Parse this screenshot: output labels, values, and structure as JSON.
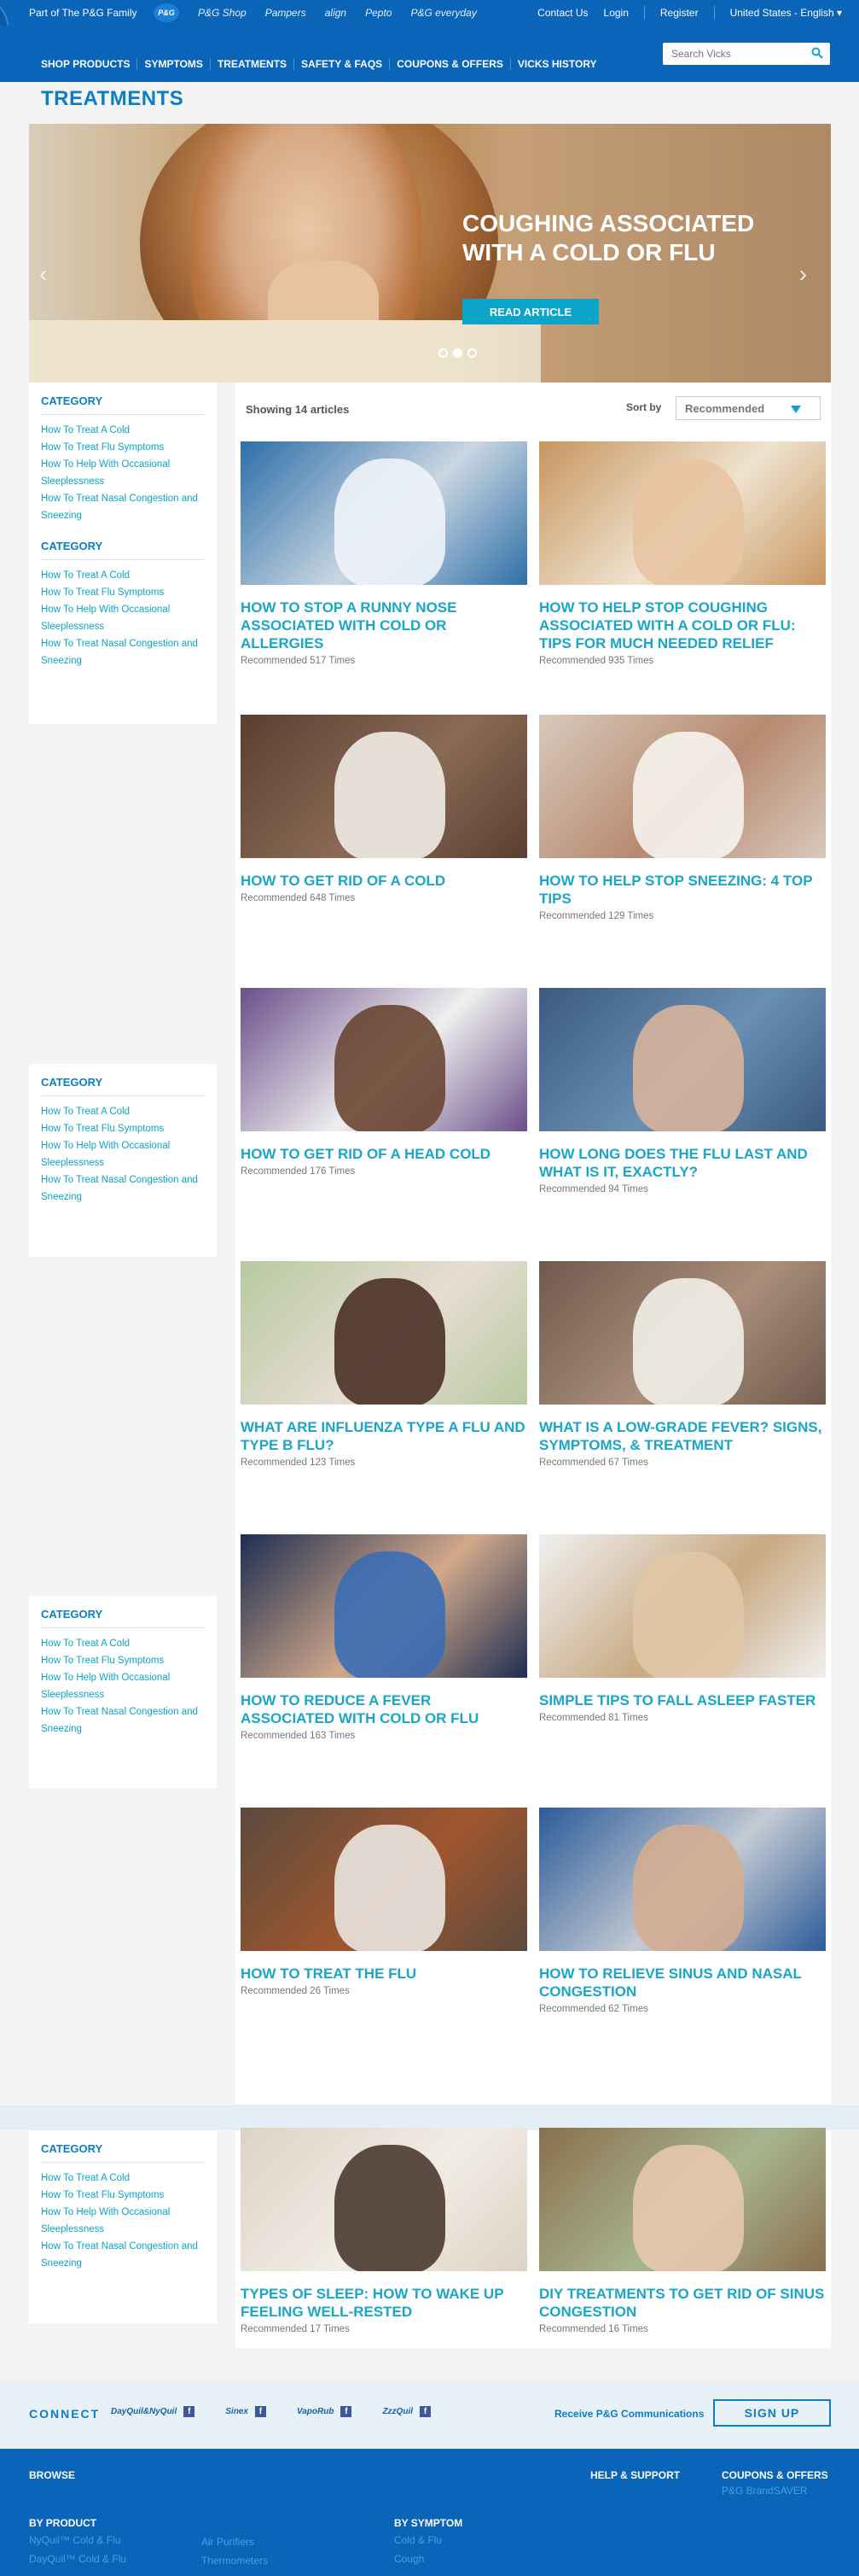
{
  "topbar": {
    "family_text": "Part of The P&G Family",
    "logos": [
      "P&G Shop",
      "Pampers",
      "align",
      "Pepto",
      "P&G everyday"
    ],
    "pg_badge": "P&G",
    "links": [
      "Contact Us",
      "Login",
      "Register",
      "United States - English ▾"
    ]
  },
  "nav": {
    "items": [
      "SHOP PRODUCTS",
      "SYMPTOMS",
      "TREATMENTS",
      "SAFETY & FAQS",
      "COUPONS & OFFERS",
      "VICKS HISTORY"
    ],
    "search_placeholder": "Search Vicks"
  },
  "page_title": "TREATMENTS",
  "hero": {
    "title": "COUGHING ASSOCIATED WITH A COLD OR FLU",
    "button": "READ ARTICLE",
    "prev": "‹",
    "next": "›",
    "slide_count": 3,
    "active_slide": 2
  },
  "sidebar": {
    "category_title": "CATEGORY",
    "links": [
      "How To Treat A Cold",
      "How To Treat Flu Symptoms",
      "How To Help With Occasional Sleeplessness",
      "How To Treat Nasal Congestion and Sneezing"
    ]
  },
  "listing": {
    "showing": "Showing 14 articles",
    "sort_label": "Sort by",
    "sort_value": "Recommended"
  },
  "articles": [
    {
      "title": "HOW TO STOP A RUNNY NOSE ASSOCIATED WITH COLD OR ALLERGIES",
      "rec": "Recommended 517 Times"
    },
    {
      "title": "HOW TO HELP STOP COUGHING ASSOCIATED WITH A COLD OR FLU: TIPS FOR MUCH NEEDED RELIEF",
      "rec": "Recommended 935 Times"
    },
    {
      "title": "HOW TO GET RID OF A COLD",
      "rec": "Recommended 648 Times"
    },
    {
      "title": "HOW TO HELP STOP SNEEZING: 4 TOP TIPS",
      "rec": "Recommended 129 Times"
    },
    {
      "title": "HOW TO GET RID OF A HEAD COLD",
      "rec": "Recommended 176 Times"
    },
    {
      "title": "HOW LONG DOES THE FLU LAST AND WHAT IS IT, EXACTLY?",
      "rec": "Recommended 94 Times"
    },
    {
      "title": "WHAT ARE INFLUENZA TYPE A FLU AND TYPE B FLU?",
      "rec": "Recommended 123 Times"
    },
    {
      "title": "WHAT IS A LOW-GRADE FEVER? SIGNS, SYMPTOMS, & TREATMENT",
      "rec": "Recommended 67 Times"
    },
    {
      "title": "HOW TO REDUCE A FEVER ASSOCIATED WITH COLD OR FLU",
      "rec": "Recommended 163 Times"
    },
    {
      "title": "SIMPLE TIPS TO FALL ASLEEP FASTER",
      "rec": "Recommended 81 Times"
    },
    {
      "title": "HOW TO TREAT THE FLU",
      "rec": "Recommended 26 Times"
    },
    {
      "title": "HOW TO RELIEVE SINUS AND NASAL CONGESTION",
      "rec": "Recommended 62 Times"
    },
    {
      "title": "TYPES OF SLEEP: HOW TO WAKE UP FEELING WELL-RESTED",
      "rec": "Recommended 17 Times"
    },
    {
      "title": "DIY TREATMENTS TO GET RID OF SINUS CONGESTION",
      "rec": "Recommended 16 Times"
    }
  ],
  "connect": {
    "label": "CONNECT",
    "brands": [
      "DayQuil&NyQuil",
      "Sinex",
      "VapoRub",
      "ZzzQuil"
    ],
    "fb": "f",
    "receive": "Receive P&G Communications",
    "signup": "SIGN UP"
  },
  "footer": {
    "browse": "BROWSE",
    "help": "HELP & SUPPORT",
    "coupons": "COUPONS & OFFERS",
    "brandsaver": "P&G BrandSAVER",
    "by_product": "BY PRODUCT",
    "by_symptom": "BY SYMPTOM",
    "products": [
      "NyQuil™ Cold & Flu",
      "DayQuil™ Cold & Flu",
      "Air Purifiers",
      "Thermometers"
    ],
    "symptoms": [
      "Cold & Flu",
      "Cough"
    ]
  },
  "colors": {
    "brand_blue": "#0a64b8",
    "accent_teal": "#1aa6c7",
    "title_blue": "#0a7fc6"
  }
}
